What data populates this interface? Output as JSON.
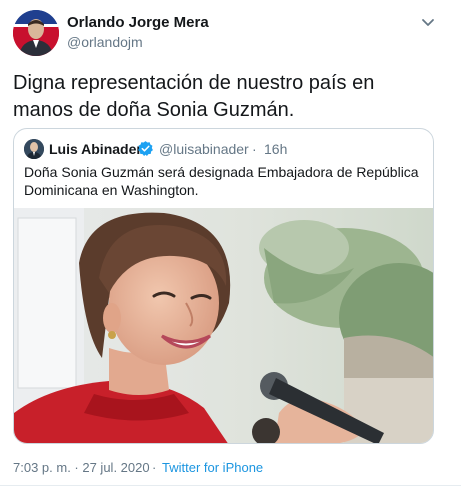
{
  "tweet": {
    "author_name": "Orlando Jorge Mera",
    "author_handle": "@orlandojm",
    "text": "Digna representación de nuestro país en manos de doña Sonia Guzmán.",
    "timestamp": "7:03 p. m. · 27 jul. 2020",
    "separator": "·",
    "source": "Twitter for iPhone"
  },
  "quote": {
    "author_name": "Luis Abinader",
    "author_handle": "@luisabinader",
    "separator": "·",
    "time": "16h",
    "text": "Doña Sonia Guzmán será designada Embajadora de República Dominicana en Washington."
  },
  "colors": {
    "link": "#1b95e0",
    "secondary_text": "#657786",
    "border": "#ccd6dd",
    "verified": "#1da1f2"
  },
  "icons": {
    "caret": "chevron-down-icon",
    "verified": "verified-badge-icon"
  }
}
